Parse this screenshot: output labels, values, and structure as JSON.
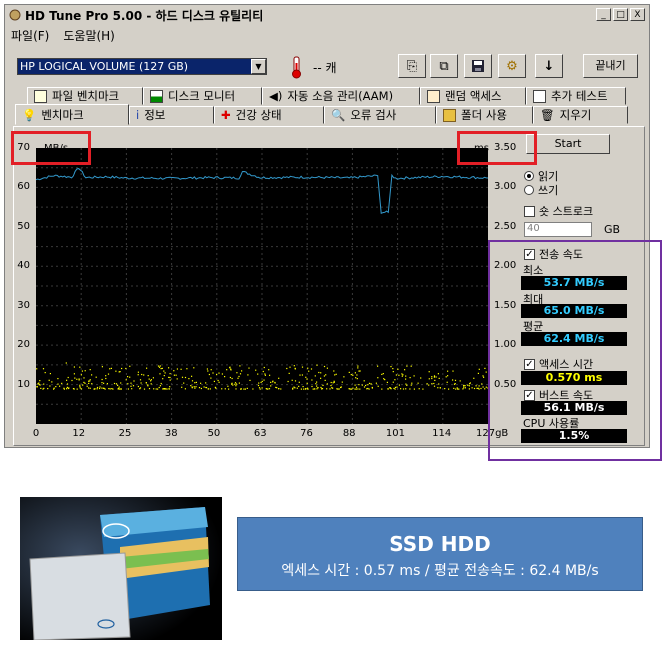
{
  "window": {
    "title": "HD Tune Pro 5.00 - 하드 디스크 유틸리티",
    "buttons": [
      "_",
      "□",
      "X"
    ]
  },
  "menu": [
    "파일(F)",
    "도움말(H)"
  ],
  "toolbar": {
    "drive": "HP     LOGICAL VOLUME   (127 GB)",
    "temperature": "-- 캐",
    "exit_label": "끝내기"
  },
  "tabs_row1": [
    "파일 벤치마크",
    "디스크 모니터",
    "자동 소음 관리(AAM)",
    "랜덤 액세스",
    "추가 테스트"
  ],
  "tabs_row2": [
    "벤치마크",
    "정보",
    "건강 상태",
    "오류 검사",
    "폴더 사용",
    "지우기"
  ],
  "chart": {
    "y_unit": "MB/s",
    "y2_unit": "ms",
    "y_ticks": [
      "70",
      "60",
      "50",
      "40",
      "30",
      "20",
      "10"
    ],
    "y2_ticks": [
      "3.50",
      "3.00",
      "2.50",
      "2.00",
      "1.50",
      "1.00",
      "0.50"
    ],
    "x_ticks": [
      "0",
      "12",
      "25",
      "38",
      "50",
      "63",
      "76",
      "88",
      "101",
      "114",
      "127gB"
    ]
  },
  "chart_data": {
    "type": "line",
    "xlabel": "gB",
    "ylabel": "MB/s",
    "y2label": "ms",
    "xlim": [
      0,
      127
    ],
    "ylim": [
      0,
      70
    ],
    "y2lim": [
      0,
      3.5
    ],
    "grid": true,
    "series": [
      {
        "name": "읽기",
        "color": "#3399cc",
        "x": [
          0,
          5,
          10,
          12,
          14,
          20,
          25,
          38,
          50,
          57,
          58,
          63,
          76,
          88,
          96,
          97,
          99,
          100,
          101,
          114,
          127
        ],
        "y": [
          62,
          63,
          62.6,
          65,
          62.5,
          62.7,
          62.4,
          62.3,
          62.5,
          62.4,
          64,
          62.5,
          62.6,
          62.4,
          63,
          53.7,
          53.7,
          63,
          62.3,
          62.8,
          62.4
        ]
      },
      {
        "name": "액세스 시간",
        "color": "#ffff00",
        "y_axis": "y2",
        "x_range": [
          0,
          127
        ],
        "y_range": [
          0.45,
          0.75
        ]
      }
    ]
  },
  "controls": {
    "start_label": "Start",
    "read_label": "읽기",
    "write_label": "쓰기",
    "short_stroke_label": "숏 스트로크",
    "short_stroke_value": "40",
    "short_stroke_unit": "GB",
    "transfer_label": "전송 속도",
    "min_label": "최소",
    "min_value": "53.7 MB/s",
    "max_label": "최대",
    "max_value": "65.0 MB/s",
    "avg_label": "평균",
    "avg_value": "62.4 MB/s",
    "access_label": "액세스 시간",
    "access_value": "0.570 ms",
    "burst_label": "버스트 속도",
    "burst_value": "56.1 MB/s",
    "cpu_label": "CPU 사용률",
    "cpu_value": "1.5%"
  },
  "colors": {
    "read_value_text": "#33ccff",
    "access_value_text": "#ffff00",
    "highlight_red": "#e21f26",
    "highlight_purple": "#7030a0",
    "info_box": "#4f81bd"
  },
  "info_box": {
    "title": "SSD HDD",
    "subtitle": "엑세스 시간 : 0.57 ms / 평균 전송속도 : 62.4 MB/s"
  }
}
